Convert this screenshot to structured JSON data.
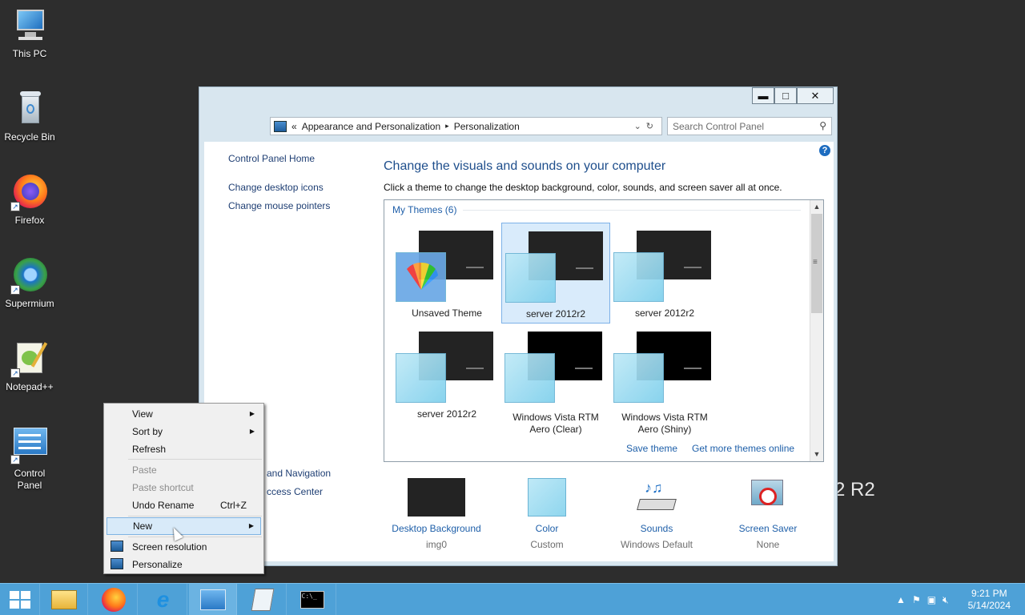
{
  "desktop": {
    "icons": [
      {
        "label": "This PC"
      },
      {
        "label": "Recycle Bin"
      },
      {
        "label": "Firefox"
      },
      {
        "label": "Supermium"
      },
      {
        "label": "Notepad++"
      },
      {
        "label": "Control Panel"
      }
    ],
    "watermark": "2 R2"
  },
  "window": {
    "controls": {
      "minimize": "▬",
      "maximize": "□",
      "close": "✕"
    },
    "address": {
      "back_chevron": "«",
      "crumbs": [
        "Appearance and Personalization",
        "Personalization"
      ],
      "separator": "▸"
    },
    "search_placeholder": "Search Control Panel",
    "help": "?",
    "left_links": [
      "Control Panel Home",
      "Change desktop icons",
      "Change mouse pointers",
      "Ease of Access Center"
    ],
    "see_also_partial": [
      "and Navigation",
      "ccess Center"
    ],
    "heading": "Change the visuals and sounds on your computer",
    "subtitle": "Click a theme to change the desktop background, color, sounds, and screen saver all at once.",
    "themes_group": "My Themes (6)",
    "themes": [
      {
        "name": "Unsaved Theme",
        "selected": false
      },
      {
        "name": "server 2012r2",
        "selected": true
      },
      {
        "name": "server 2012r2",
        "selected": false
      },
      {
        "name": "server 2012r2",
        "selected": false
      },
      {
        "name": "Windows Vista RTM Aero (Clear)",
        "selected": false
      },
      {
        "name": "Windows Vista RTM Aero (Shiny)",
        "selected": false
      }
    ],
    "save_theme": "Save theme",
    "get_more": "Get more themes online",
    "bottom": [
      {
        "link": "Desktop Background",
        "value": "img0"
      },
      {
        "link": "Color",
        "value": "Custom"
      },
      {
        "link": "Sounds",
        "value": "Windows Default"
      },
      {
        "link": "Screen Saver",
        "value": "None"
      }
    ]
  },
  "context_menu": {
    "items": [
      {
        "label": "View",
        "submenu": true
      },
      {
        "label": "Sort by",
        "submenu": true
      },
      {
        "label": "Refresh"
      },
      {
        "label": "Paste",
        "disabled": true
      },
      {
        "label": "Paste shortcut",
        "disabled": true
      },
      {
        "label": "Undo Rename",
        "shortcut": "Ctrl+Z"
      },
      {
        "label": "New",
        "submenu": true,
        "highlighted": true
      },
      {
        "label": "Screen resolution"
      },
      {
        "label": "Personalize"
      }
    ]
  },
  "taskbar": {
    "clock_time": "9:21 PM",
    "clock_date": "5/14/2024"
  }
}
